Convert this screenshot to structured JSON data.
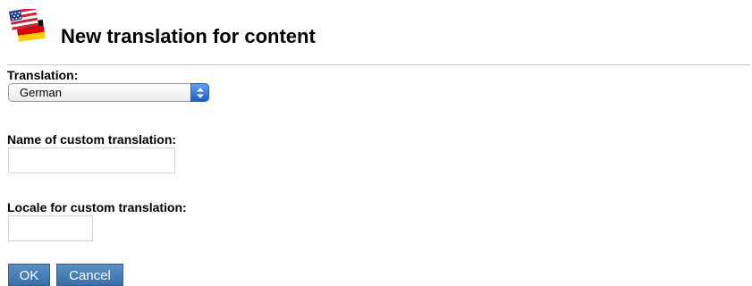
{
  "header": {
    "title": "New translation for content",
    "icon": "us-german-flags-icon"
  },
  "form": {
    "translation_label": "Translation:",
    "translation_selected": "German",
    "custom_name_label": "Name of custom translation:",
    "custom_name_value": "",
    "custom_locale_label": "Locale for custom translation:",
    "custom_locale_value": ""
  },
  "buttons": {
    "ok_label": "OK",
    "cancel_label": "Cancel"
  },
  "colors": {
    "button_bg": "#4a7fb8",
    "select_arrow_bg": "#2f6fe0",
    "rule": "#c8c8c8"
  }
}
